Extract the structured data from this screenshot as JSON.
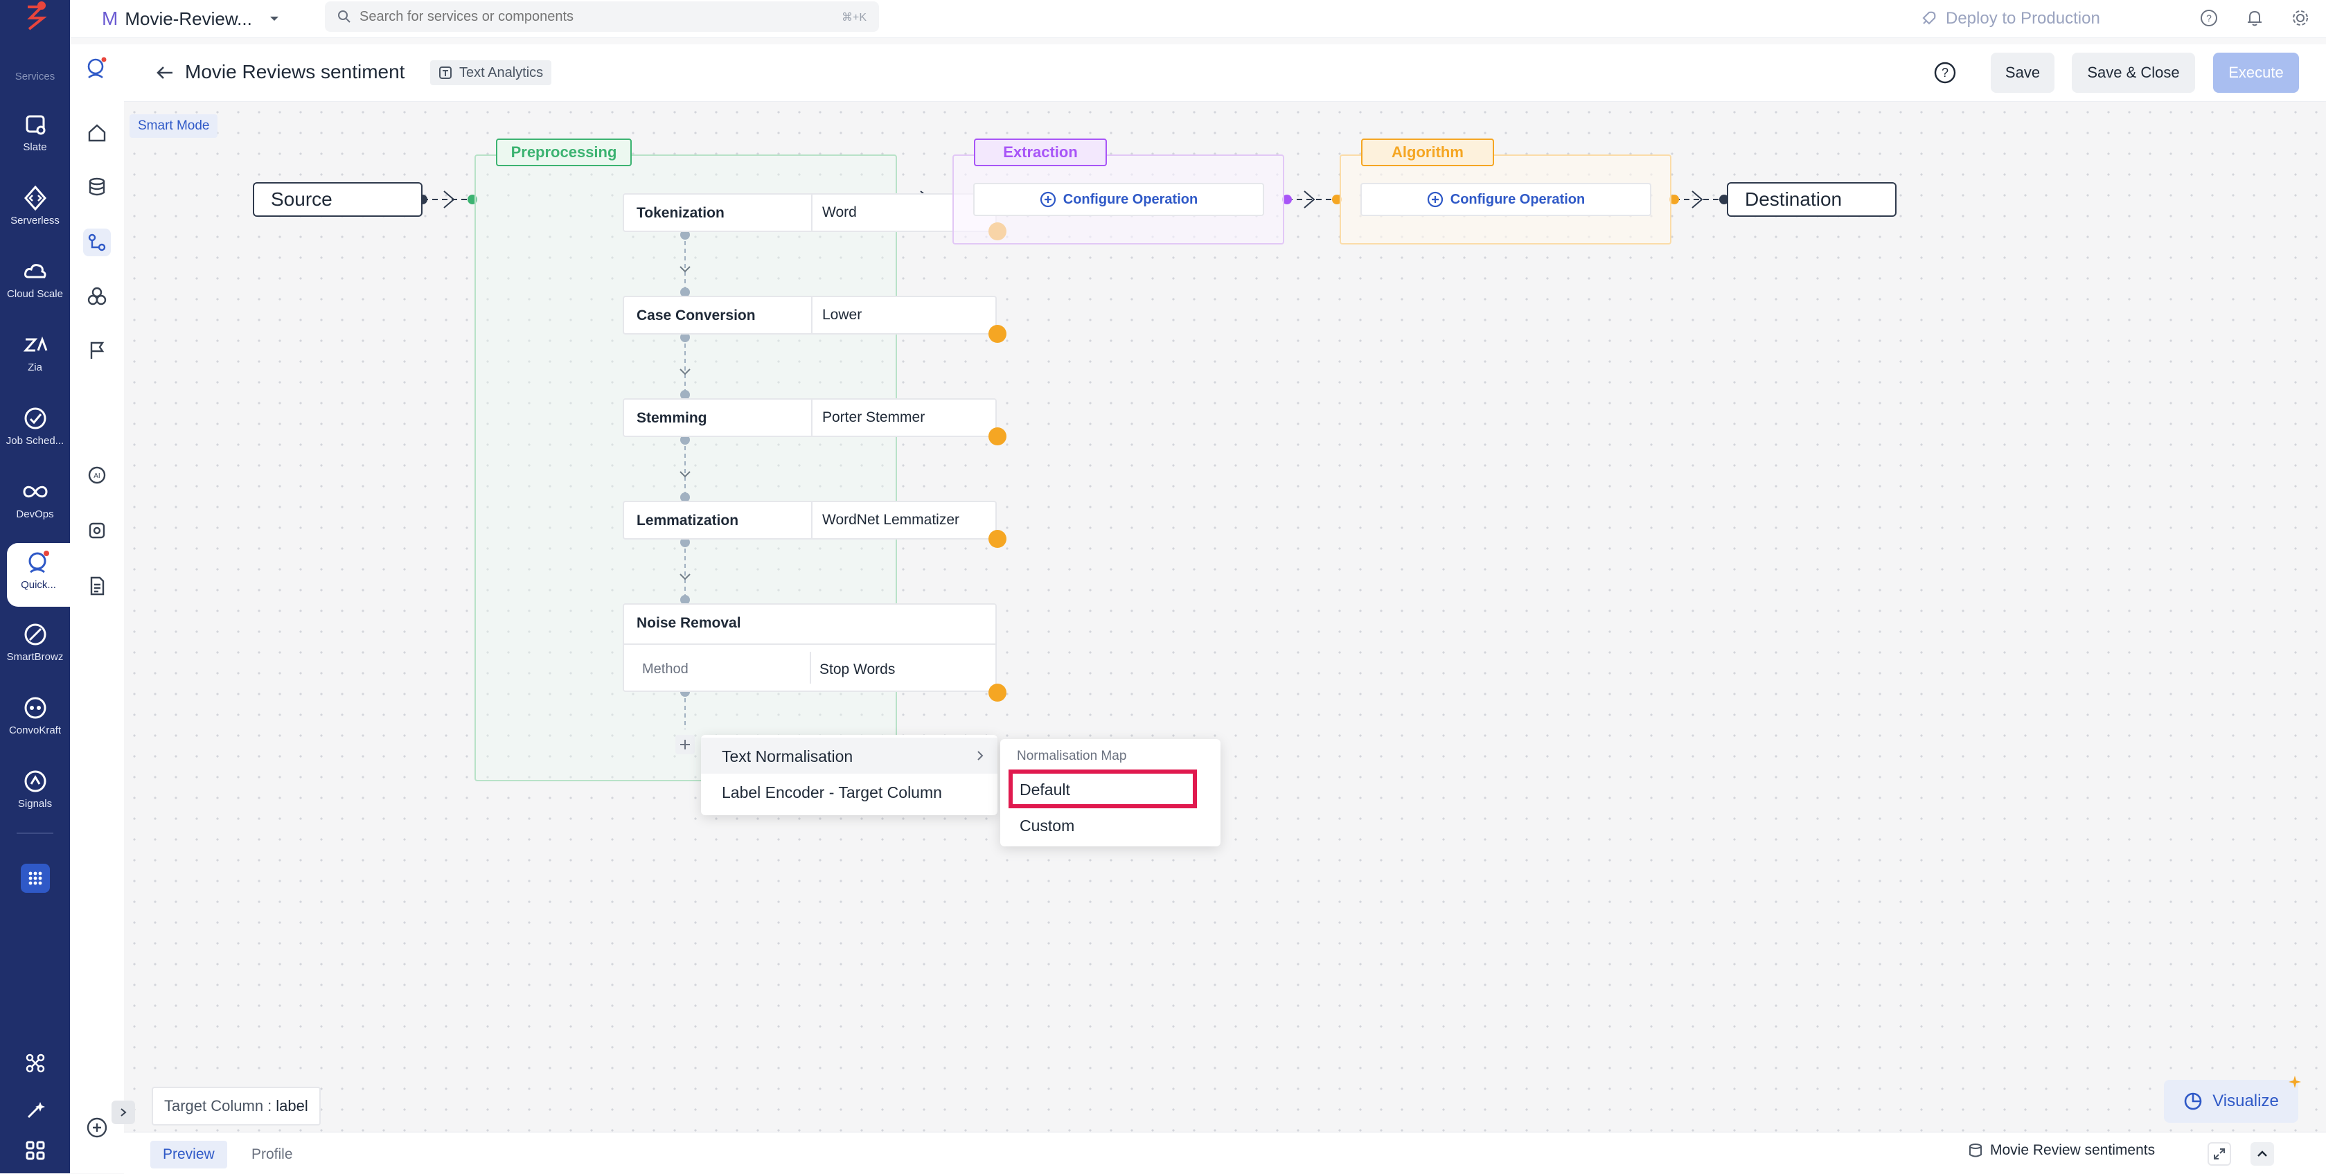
{
  "rail": {
    "top_label": "Services",
    "items": [
      {
        "label": "Slate",
        "icon": "slate-icon"
      },
      {
        "label": "Serverless",
        "icon": "serverless-icon"
      },
      {
        "label": "Cloud Scale",
        "icon": "cloud-icon"
      },
      {
        "label": "Zia",
        "icon": "zia-icon"
      },
      {
        "label": "Job Sched...",
        "icon": "job-scheduler-icon"
      },
      {
        "label": "DevOps",
        "icon": "devops-icon"
      },
      {
        "label": "Quick...",
        "icon": "quickml-icon"
      },
      {
        "label": "SmartBrowz",
        "icon": "smartbrowz-icon"
      },
      {
        "label": "ConvoKraft",
        "icon": "convokraft-icon"
      },
      {
        "label": "Signals",
        "icon": "signals-icon"
      }
    ]
  },
  "topbar": {
    "project_initial": "M",
    "project_name": "Movie-Review...",
    "search_placeholder": "Search for services or components",
    "search_shortcut": "⌘+K",
    "deploy_label": "Deploy to Production"
  },
  "subbar": {
    "title": "Movie Reviews sentiment",
    "badge": "Text Analytics",
    "save": "Save",
    "save_close": "Save & Close",
    "execute": "Execute"
  },
  "canvas": {
    "smart_mode": "Smart Mode",
    "source": "Source",
    "destination": "Destination",
    "preprocessing": "Preprocessing",
    "extraction": "Extraction",
    "algorithm": "Algorithm",
    "configure_operation": "Configure Operation",
    "steps": [
      {
        "name": "Tokenization",
        "value": "Word"
      },
      {
        "name": "Case Conversion",
        "value": "Lower"
      },
      {
        "name": "Stemming",
        "value": "Porter Stemmer"
      },
      {
        "name": "Lemmatization",
        "value": "WordNet Lemmatizer"
      }
    ],
    "noise_removal": {
      "name": "Noise Removal",
      "method_label": "Method",
      "method_value": "Stop Words"
    }
  },
  "menu": {
    "items": [
      "Text Normalisation",
      "Label Encoder - Target Column"
    ],
    "submenu_header": "Normalisation Map",
    "submenu_items": [
      "Default",
      "Custom"
    ]
  },
  "footer": {
    "target_label": "Target Column :",
    "target_value": "label",
    "visualize": "Visualize",
    "tabs": [
      "Preview",
      "Profile"
    ],
    "dataset": "Movie Review sentiments"
  },
  "colors": {
    "rail": "#1f2f6b",
    "accent": "#2f59c7",
    "preprocessing": "#3cb371",
    "extraction": "#a855f7",
    "algorithm": "#f5a623",
    "highlight": "#e0194e"
  }
}
